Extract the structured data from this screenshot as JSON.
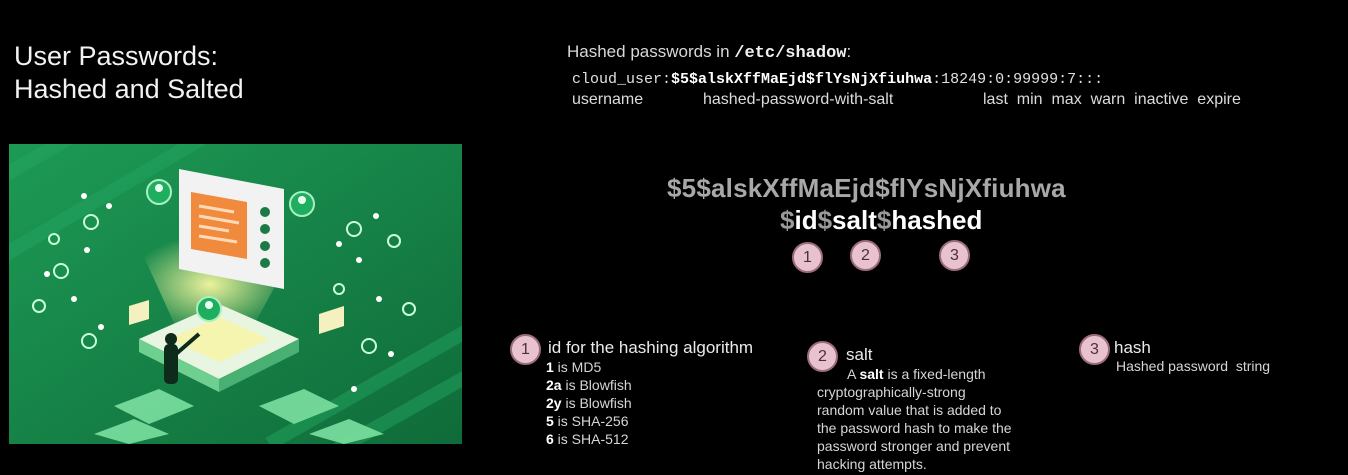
{
  "slide": {
    "title_lines": [
      "User Passwords:",
      "Hashed and Salted"
    ]
  },
  "shadow": {
    "heading_prefix": "Hashed passwords in ",
    "heading_path": "/etc/shadow",
    "heading_suffix": ":",
    "line_user": "cloud_user:",
    "line_hash": "$5$alskXffMaEjd$flYsNjXfiuhwa",
    "line_rest": ":18249:0:99999:7:::",
    "fields": {
      "username": "username",
      "hash": "hashed-password-with-salt",
      "rest": "last  min  max  warn  inactive  expire"
    }
  },
  "format": {
    "full_hash": "$5$alskXffMaEjd$flYsNjXfiuhwa",
    "d1": "$",
    "id": "id",
    "d2": "$",
    "salt": "salt",
    "d3": "$",
    "hashed": "hashed"
  },
  "badges": [
    "1",
    "2",
    "3"
  ],
  "id_section": {
    "badge": "1",
    "title": "id for the hashing algorithm",
    "items": [
      {
        "code": "1",
        "text": " is MD5"
      },
      {
        "code": "2a",
        "text": " is Blowfish"
      },
      {
        "code": "2y",
        "text": " is Blowfish"
      },
      {
        "code": "5",
        "text": " is SHA-256"
      },
      {
        "code": "6",
        "text": " is SHA-512"
      }
    ]
  },
  "salt_section": {
    "badge": "2",
    "title": "salt",
    "line1_pre": "A ",
    "line1_bold": "salt",
    "line1_post": " is a fixed-length",
    "lines": [
      "cryptographically-strong",
      "random value that is added to",
      "the password hash to make the",
      "password stronger and prevent",
      "hacking attempts."
    ]
  },
  "hash_section": {
    "badge": "3",
    "title": "hash",
    "desc": "Hashed password  string"
  },
  "colors": {
    "illustration_green": "#1f8a4c",
    "badge_fill": "#e8c3cf",
    "badge_border": "#9b6c7e"
  }
}
